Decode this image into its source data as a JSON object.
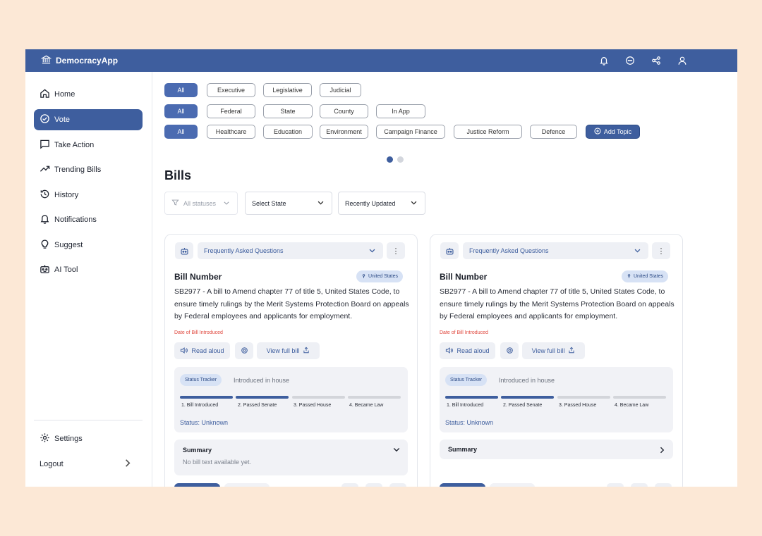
{
  "app": {
    "name": "DemocracyApp"
  },
  "header_icons": [
    "bell-icon",
    "chat-icon",
    "share-icon",
    "user-icon"
  ],
  "sidebar": {
    "items": [
      {
        "label": "Home",
        "icon": "home-icon"
      },
      {
        "label": "Vote",
        "icon": "check-circle-icon",
        "active": true
      },
      {
        "label": "Take Action",
        "icon": "message-square-icon"
      },
      {
        "label": "Trending Bills",
        "icon": "trending-up-icon"
      },
      {
        "label": "History",
        "icon": "history-icon"
      },
      {
        "label": "Notifications",
        "icon": "bell-icon"
      },
      {
        "label": "Suggest",
        "icon": "lightbulb-icon"
      },
      {
        "label": "AI Tool",
        "icon": "robot-icon"
      }
    ],
    "settings": "Settings",
    "logout": "Logout"
  },
  "filters": {
    "branch": {
      "all": "All",
      "items": [
        "Executive",
        "Legislative",
        "Judicial"
      ]
    },
    "level": {
      "all": "All",
      "items": [
        "Federal",
        "State",
        "County",
        "In App"
      ]
    },
    "topics": {
      "all": "All",
      "items": [
        "Healthcare",
        "Education",
        "Environment",
        "Campaign Finance",
        "Justice Reform",
        "Defence"
      ],
      "add": "Add Topic"
    }
  },
  "colors": {
    "primary": "#3e5e9e",
    "accent": "#4b6bb1",
    "date_red": "#e0483e",
    "background": "#fce8d6"
  },
  "bills": {
    "title": "Bills",
    "status_filter": {
      "placeholder": "All statuses"
    },
    "state_filter": {
      "value": "Select State"
    },
    "sort_filter": {
      "value": "Recently Updated"
    }
  },
  "cards": [
    {
      "faq": "Frequently Asked Questions",
      "bill_number": "Bill Number",
      "badge": "United States",
      "description": "SB2977 - A bill to Amend chapter 77 of title 5, United States Code, to ensure timely rulings by the Merit Systems Protection Board on appeals by Federal employees and applicants for employment.",
      "date_label": "Date of Bill Introduced",
      "read_aloud": "Read aloud",
      "view_full": "View full bill",
      "tracker": {
        "label": "Status Tracker",
        "stage": "Introduced in house",
        "steps": [
          "1. Bill Introduced",
          "2. Passed Senate",
          "3. Passed House",
          "4. Became Law"
        ],
        "completed_steps": 2,
        "status": "Status: Unknown"
      },
      "summary": {
        "title": "Summary",
        "text": "No bill text available yet.",
        "expanded": true
      }
    },
    {
      "faq": "Frequently Asked Questions",
      "bill_number": "Bill Number",
      "badge": "United States",
      "description": "SB2977 - A bill to Amend chapter 77 of title 5, United States Code, to ensure timely rulings by the Merit Systems Protection Board on appeals by Federal employees and applicants for employment.",
      "date_label": "Date of Bill Introduced",
      "read_aloud": "Read aloud",
      "view_full": "View full bill",
      "tracker": {
        "label": "Status Tracker",
        "stage": "Introduced in house",
        "steps": [
          "1. Bill Introduced",
          "2. Passed Senate",
          "3. Passed House",
          "4. Became Law"
        ],
        "completed_steps": 2,
        "status": "Status: Unknown"
      },
      "summary": {
        "title": "Summary",
        "text": "",
        "expanded": false
      }
    }
  ]
}
